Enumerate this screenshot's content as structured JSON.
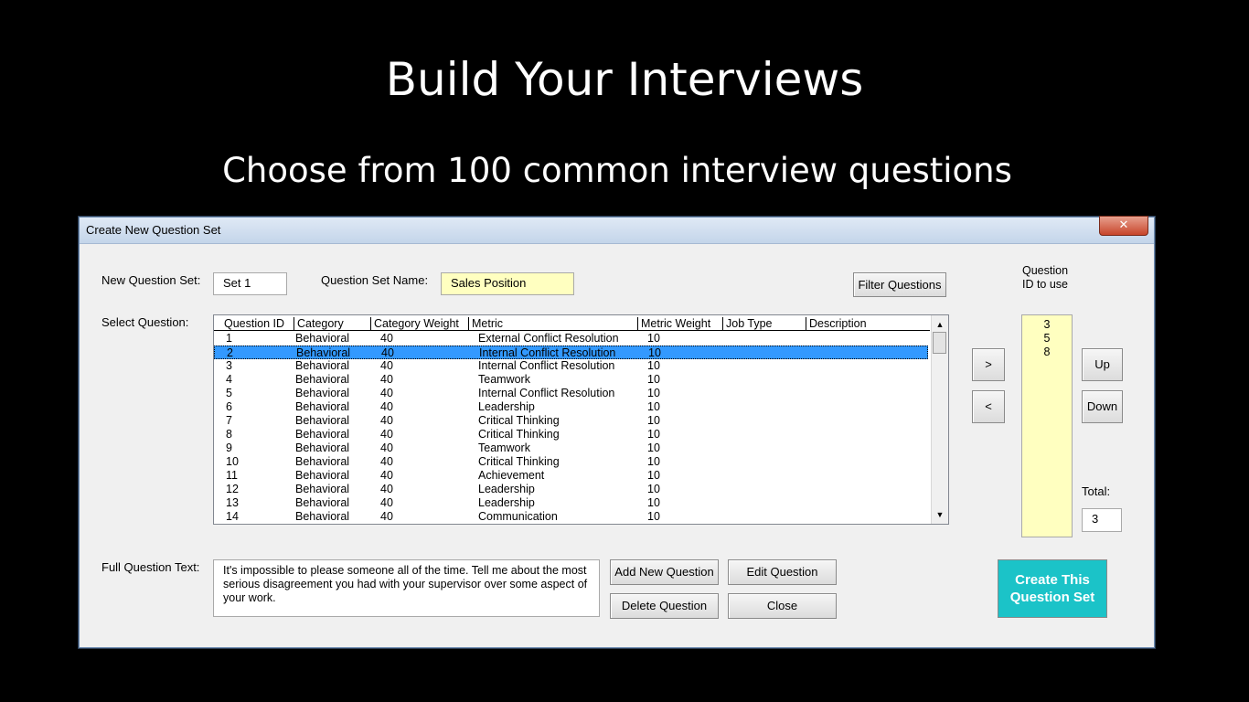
{
  "slide": {
    "title": "Build Your Interviews",
    "subtitle": "Choose from 100 common interview questions"
  },
  "dialog": {
    "title": "Create New Question Set",
    "close_glyph": "✕",
    "labels": {
      "new_set": "New Question Set:",
      "set_name": "Question Set Name:",
      "select_question": "Select Question:",
      "full_text": "Full Question Text:",
      "qid_to_use": "Question ID to use",
      "total": "Total:"
    },
    "fields": {
      "new_set_value": "Set 1",
      "set_name_value": "Sales Position",
      "total_value": "3",
      "full_text_value": "It's impossible to please someone all of the time. Tell me about the most serious disagreement you had with your supervisor over some aspect of your work."
    },
    "buttons": {
      "filter": "Filter Questions",
      "add_right": ">",
      "remove_left": "<",
      "up": "Up",
      "down": "Down",
      "add_new": "Add New Question",
      "edit": "Edit Question",
      "delete": "Delete Question",
      "close": "Close",
      "create": "Create This Question Set"
    },
    "columns": [
      "Question ID",
      "Category",
      "Category Weight",
      "Metric",
      "Metric Weight",
      "Job Type",
      "Description"
    ],
    "rows": [
      [
        "1",
        "Behavioral",
        "40",
        "External Conflict Resolution",
        "10"
      ],
      [
        "2",
        "Behavioral",
        "40",
        "Internal Conflict Resolution",
        "10"
      ],
      [
        "3",
        "Behavioral",
        "40",
        "Internal Conflict Resolution",
        "10"
      ],
      [
        "4",
        "Behavioral",
        "40",
        "Teamwork",
        "10"
      ],
      [
        "5",
        "Behavioral",
        "40",
        "Internal Conflict Resolution",
        "10"
      ],
      [
        "6",
        "Behavioral",
        "40",
        "Leadership",
        "10"
      ],
      [
        "7",
        "Behavioral",
        "40",
        "Critical Thinking",
        "10"
      ],
      [
        "8",
        "Behavioral",
        "40",
        "Critical Thinking",
        "10"
      ],
      [
        "9",
        "Behavioral",
        "40",
        "Teamwork",
        "10"
      ],
      [
        "10",
        "Behavioral",
        "40",
        "Critical Thinking",
        "10"
      ],
      [
        "11",
        "Behavioral",
        "40",
        "Achievement",
        "10"
      ],
      [
        "12",
        "Behavioral",
        "40",
        "Leadership",
        "10"
      ],
      [
        "13",
        "Behavioral",
        "40",
        "Leadership",
        "10"
      ],
      [
        "14",
        "Behavioral",
        "40",
        "Communication",
        "10"
      ]
    ],
    "selected_row": 1,
    "qids_to_use": [
      "3",
      "5",
      "8"
    ],
    "accent_color": "#1bc3c8",
    "selection_color": "#3399ff",
    "highlight_field_color": "#ffffc0"
  }
}
